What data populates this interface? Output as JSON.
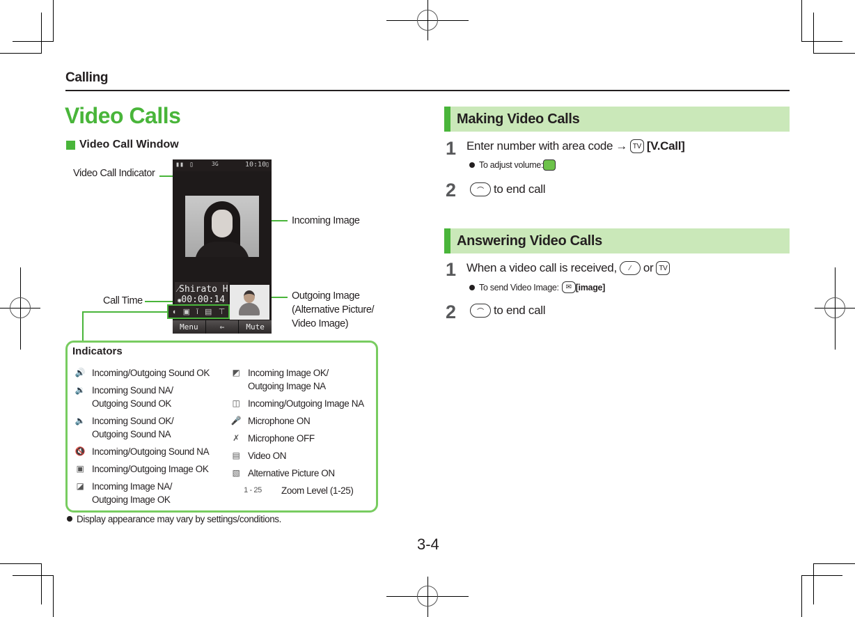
{
  "running_head": "Calling",
  "page_title": "Video Calls",
  "subsection": "Video Call Window",
  "callouts": {
    "video_call_indicator": "Video Call Indicator",
    "incoming_image": "Incoming Image",
    "call_time": "Call Time",
    "outgoing_image": "Outgoing Image\n(Alternative Picture/\nVideo Image)"
  },
  "phone_screen": {
    "status_clock": "10:10",
    "status_badge": "3G",
    "caller_name": "Shirato H",
    "call_time": "00:00:14",
    "softkeys": [
      "Menu",
      "⇐",
      "Mute"
    ]
  },
  "indicators": {
    "title": "Indicators",
    "left": [
      {
        "icon": "sound-ok-icon",
        "glyph": "🔊",
        "label": "Incoming/Outgoing Sound OK"
      },
      {
        "icon": "sound-in-na-icon",
        "glyph": "🔉",
        "label": "Incoming Sound NA/\nOutgoing Sound OK"
      },
      {
        "icon": "sound-out-na-icon",
        "glyph": "🔈",
        "label": "Incoming Sound OK/\nOutgoing Sound NA"
      },
      {
        "icon": "sound-na-icon",
        "glyph": "🔇",
        "label": "Incoming/Outgoing Sound NA"
      },
      {
        "icon": "image-ok-icon",
        "glyph": "▣",
        "label": "Incoming/Outgoing Image OK"
      },
      {
        "icon": "image-in-na-icon",
        "glyph": "◪",
        "label": "Incoming Image NA/\nOutgoing Image OK"
      }
    ],
    "right": [
      {
        "icon": "image-out-na-icon",
        "glyph": "◩",
        "label": "Incoming Image OK/\nOutgoing Image NA"
      },
      {
        "icon": "image-na-icon",
        "glyph": "◫",
        "label": "Incoming/Outgoing Image NA"
      },
      {
        "icon": "microphone-on-icon",
        "glyph": "🎤",
        "label": "Microphone ON"
      },
      {
        "icon": "microphone-off-icon",
        "glyph": "✗",
        "label": "Microphone OFF"
      },
      {
        "icon": "video-on-icon",
        "glyph": "▤",
        "label": "Video ON"
      },
      {
        "icon": "alt-picture-icon",
        "glyph": "▧",
        "label": "Alternative Picture ON"
      },
      {
        "icon": "zoom-level-icon",
        "glyph": "1 - 25",
        "label": "Zoom Level (1-25)"
      }
    ]
  },
  "note": "Display appearance may vary by settings/conditions.",
  "page_number": "3-4",
  "making": {
    "heading": "Making Video Calls",
    "step1_num": "1",
    "step1_text": "Enter number with area code",
    "step1_arrow": "→",
    "step1_key": "TV",
    "step1_action": "[V.Call]",
    "step1_note": "To adjust volume:",
    "step2_num": "2",
    "step2_text": "to end call"
  },
  "answering": {
    "heading": "Answering Video Calls",
    "step1_num": "1",
    "step1_text": "When a video call is received,",
    "step1_or": "or",
    "step1_key": "TV",
    "step1_note": "To send Video Image:",
    "step1_note_action": "[image]",
    "step2_num": "2",
    "step2_text": "to end call"
  },
  "colors": {
    "accent_green": "#49b53a",
    "section_bg": "#cae8b9",
    "box_border": "#78cc60"
  }
}
